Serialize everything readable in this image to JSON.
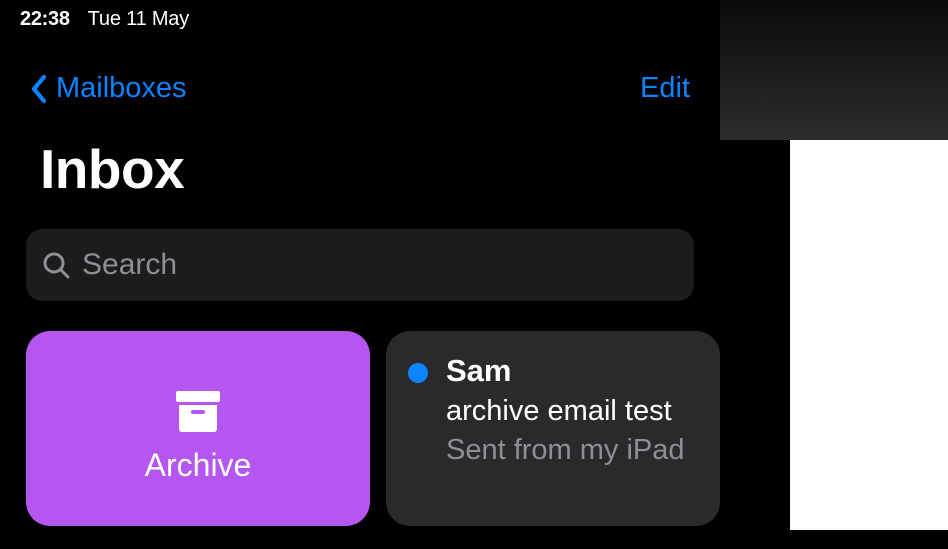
{
  "status": {
    "time": "22:38",
    "date": "Tue 11 May"
  },
  "nav": {
    "back_label": "Mailboxes",
    "edit_label": "Edit"
  },
  "title": "Inbox",
  "search": {
    "placeholder": "Search"
  },
  "swipe_action": {
    "label": "Archive"
  },
  "message": {
    "sender": "Sam",
    "subject": "archive email test",
    "preview": "Sent from my iPad",
    "unread": true
  },
  "colors": {
    "accent": "#0a84ff",
    "archive": "#b456ef"
  }
}
